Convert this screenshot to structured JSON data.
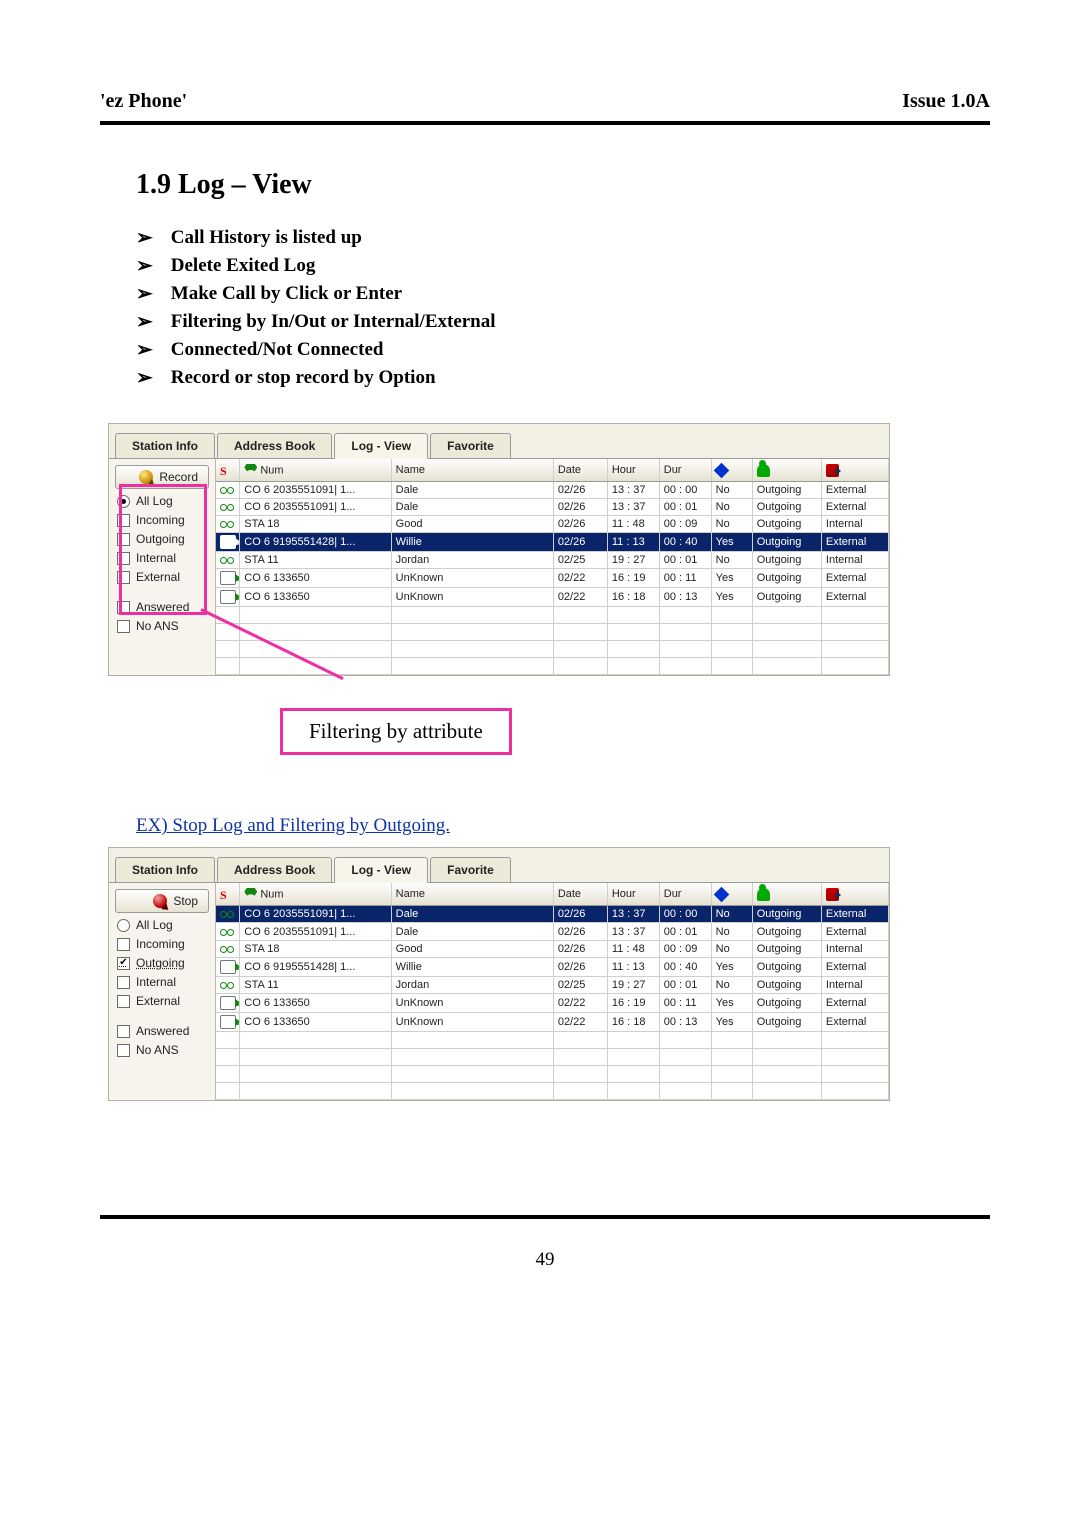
{
  "header": {
    "left": "'ez Phone'",
    "right": "Issue 1.0A"
  },
  "section_title": "1.9 Log – View",
  "features": [
    "Call History is listed up",
    "Delete Exited Log",
    "Make Call by Click or Enter",
    "Filtering by In/Out or Internal/External",
    "Connected/Not Connected",
    "Record or stop record by Option"
  ],
  "callout_label": "Filtering by attribute",
  "example_text": "EX) Stop Log and Filtering by Outgoing.",
  "page_number": "49",
  "tabs": {
    "station_info": "Station Info",
    "address_book": "Address Book",
    "log_view": "Log - View",
    "favorite": "Favorite"
  },
  "side": {
    "record_btn": "Record",
    "stop_btn": "Stop",
    "all_log": "All Log",
    "incoming": "Incoming",
    "outgoing": "Outgoing",
    "internal": "Internal",
    "external": "External",
    "answered": "Answered",
    "no_ans": "No ANS"
  },
  "log_headers": {
    "s": "S",
    "num": "Num",
    "name": "Name",
    "date": "Date",
    "hour": "Hour",
    "dur": "Dur"
  },
  "shot1": {
    "selected_row_index": 3,
    "rows": [
      {
        "stat": "noans",
        "num": "CO  6 2035551091| 1...",
        "name": "Dale",
        "date": "02/26",
        "hour": "13 : 37",
        "dur": "00 : 00",
        "conn": "No",
        "dir": "Outgoing",
        "route": "External"
      },
      {
        "stat": "noans",
        "num": "CO  6 2035551091| 1...",
        "name": "Dale",
        "date": "02/26",
        "hour": "13 : 37",
        "dur": "00 : 01",
        "conn": "No",
        "dir": "Outgoing",
        "route": "External"
      },
      {
        "stat": "noans",
        "num": "STA  18",
        "name": "Good",
        "date": "02/26",
        "hour": "11 : 48",
        "dur": "00 : 09",
        "conn": "No",
        "dir": "Outgoing",
        "route": "Internal"
      },
      {
        "stat": "out",
        "num": "CO  6 9195551428| 1...",
        "name": "Willie",
        "date": "02/26",
        "hour": "11 : 13",
        "dur": "00 : 40",
        "conn": "Yes",
        "dir": "Outgoing",
        "route": "External"
      },
      {
        "stat": "noans",
        "num": "STA  11",
        "name": "Jordan",
        "date": "02/25",
        "hour": "19 : 27",
        "dur": "00 : 01",
        "conn": "No",
        "dir": "Outgoing",
        "route": "Internal"
      },
      {
        "stat": "out",
        "num": "CO  6 133650",
        "name": "UnKnown",
        "date": "02/22",
        "hour": "16 : 19",
        "dur": "00 : 11",
        "conn": "Yes",
        "dir": "Outgoing",
        "route": "External"
      },
      {
        "stat": "out",
        "num": "CO  6 133650",
        "name": "UnKnown",
        "date": "02/22",
        "hour": "16 : 18",
        "dur": "00 : 13",
        "conn": "Yes",
        "dir": "Outgoing",
        "route": "External"
      }
    ],
    "side_state": {
      "all_log": true,
      "incoming": false,
      "outgoing": false,
      "internal": false,
      "external": false,
      "answered": false,
      "no_ans": false
    }
  },
  "shot2": {
    "selected_row_index": 0,
    "rows": [
      {
        "stat": "noans",
        "num": "CO  6 2035551091| 1...",
        "name": "Dale",
        "date": "02/26",
        "hour": "13 : 37",
        "dur": "00 : 00",
        "conn": "No",
        "dir": "Outgoing",
        "route": "External"
      },
      {
        "stat": "noans",
        "num": "CO  6 2035551091| 1...",
        "name": "Dale",
        "date": "02/26",
        "hour": "13 : 37",
        "dur": "00 : 01",
        "conn": "No",
        "dir": "Outgoing",
        "route": "External"
      },
      {
        "stat": "noans",
        "num": "STA  18",
        "name": "Good",
        "date": "02/26",
        "hour": "11 : 48",
        "dur": "00 : 09",
        "conn": "No",
        "dir": "Outgoing",
        "route": "Internal"
      },
      {
        "stat": "out",
        "num": "CO  6 9195551428| 1...",
        "name": "Willie",
        "date": "02/26",
        "hour": "11 : 13",
        "dur": "00 : 40",
        "conn": "Yes",
        "dir": "Outgoing",
        "route": "External"
      },
      {
        "stat": "noans",
        "num": "STA  11",
        "name": "Jordan",
        "date": "02/25",
        "hour": "19 : 27",
        "dur": "00 : 01",
        "conn": "No",
        "dir": "Outgoing",
        "route": "Internal"
      },
      {
        "stat": "out",
        "num": "CO  6 133650",
        "name": "UnKnown",
        "date": "02/22",
        "hour": "16 : 19",
        "dur": "00 : 11",
        "conn": "Yes",
        "dir": "Outgoing",
        "route": "External"
      },
      {
        "stat": "out",
        "num": "CO  6 133650",
        "name": "UnKnown",
        "date": "02/22",
        "hour": "16 : 18",
        "dur": "00 : 13",
        "conn": "Yes",
        "dir": "Outgoing",
        "route": "External"
      }
    ],
    "side_state": {
      "all_log": false,
      "incoming": false,
      "outgoing": true,
      "internal": false,
      "external": false,
      "answered": false,
      "no_ans": false
    }
  }
}
